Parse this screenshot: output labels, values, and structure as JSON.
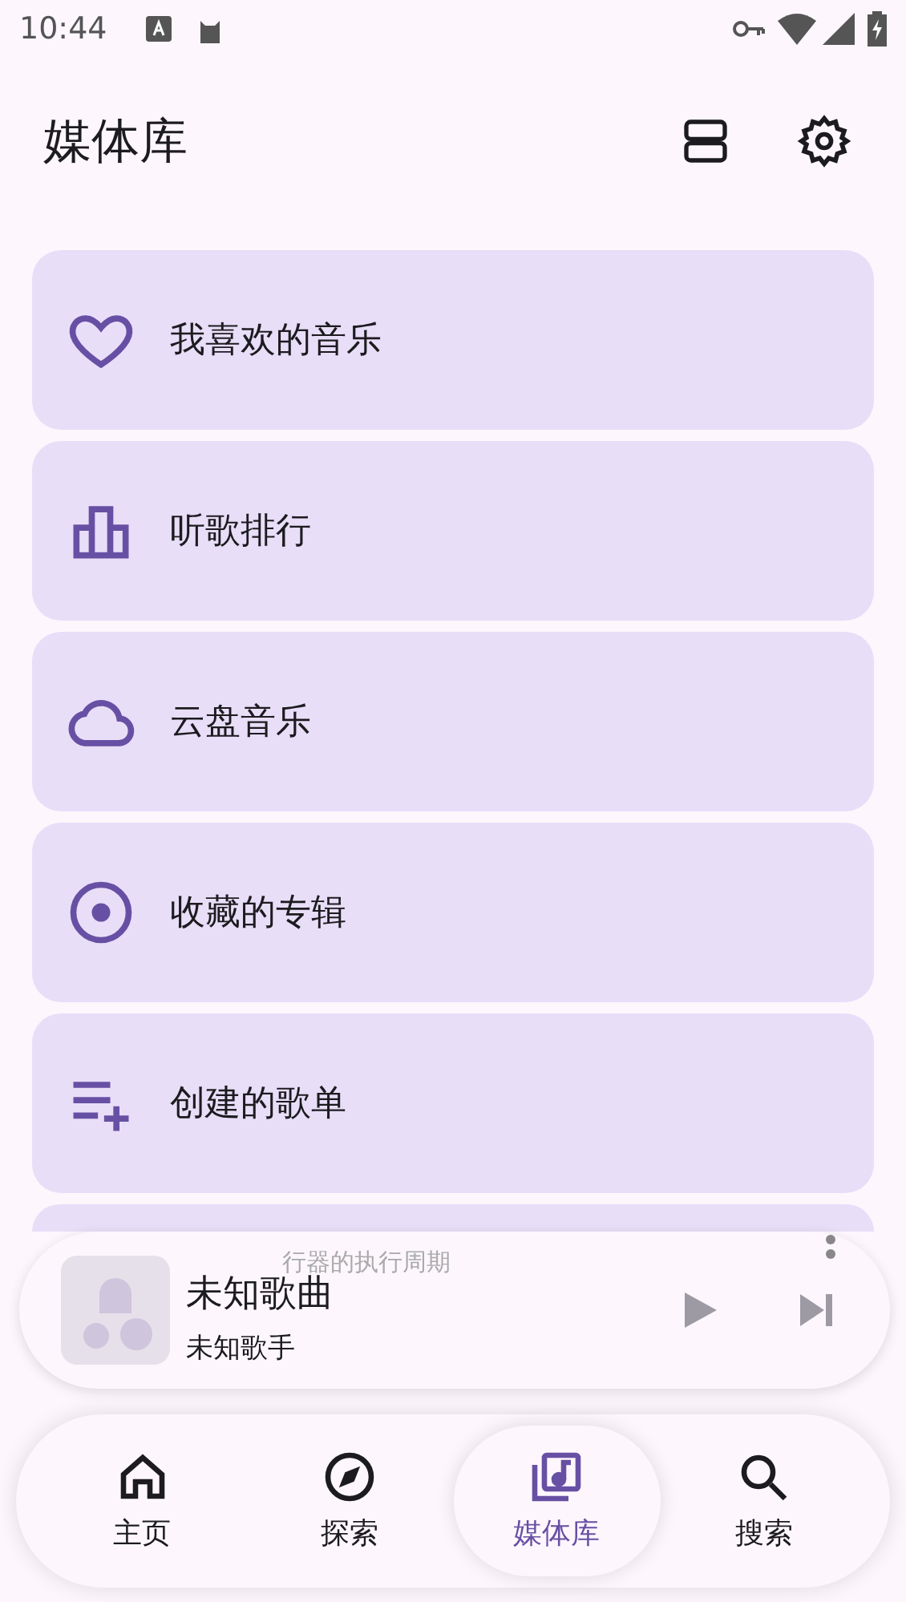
{
  "status_bar": {
    "time": "10:44"
  },
  "header": {
    "title": "媒体库"
  },
  "library_items": [
    {
      "kind": "heart",
      "label": "我喜欢的音乐"
    },
    {
      "kind": "chart",
      "label": "听歌排行"
    },
    {
      "kind": "cloud",
      "label": "云盘音乐"
    },
    {
      "kind": "disc",
      "label": "收藏的专辑"
    },
    {
      "kind": "playlist",
      "label": "创建的歌单"
    }
  ],
  "mini_player": {
    "title": "未知歌曲",
    "artist": "未知歌手",
    "lyric": "行器的执行周期"
  },
  "bottom_nav": [
    {
      "kind": "home",
      "label": "主页",
      "selected": false
    },
    {
      "kind": "explore",
      "label": "探索",
      "selected": false
    },
    {
      "kind": "library",
      "label": "媒体库",
      "selected": true
    },
    {
      "kind": "search",
      "label": "搜索",
      "selected": false
    }
  ]
}
